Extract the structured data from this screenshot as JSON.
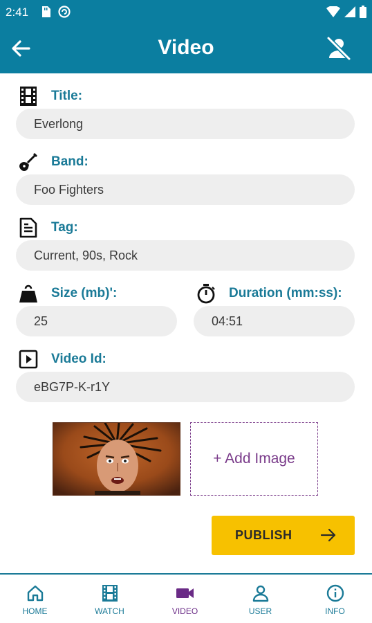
{
  "status": {
    "time": "2:41"
  },
  "header": {
    "title": "Video"
  },
  "fields": {
    "title": {
      "label": "Title:",
      "value": "Everlong"
    },
    "band": {
      "label": "Band:",
      "value": "Foo Fighters"
    },
    "tag": {
      "label": "Tag:",
      "value": "Current, 90s, Rock"
    },
    "size": {
      "label": "Size (mb)':",
      "value": "25"
    },
    "duration": {
      "label": "Duration (mm:ss):",
      "value": "04:51"
    },
    "video_id": {
      "label": "Video Id:",
      "value": "eBG7P-K-r1Y"
    }
  },
  "images": {
    "add_label": "+ Add Image"
  },
  "publish": {
    "label": "PUBLISH"
  },
  "nav": [
    {
      "label": "HOME",
      "icon": "home-icon"
    },
    {
      "label": "WATCH",
      "icon": "film-icon"
    },
    {
      "label": "VIDEO",
      "icon": "videocam-icon"
    },
    {
      "label": "USER",
      "icon": "user-icon"
    },
    {
      "label": "INFO",
      "icon": "info-icon"
    }
  ],
  "colors": {
    "primary": "#0b7ea0",
    "label": "#1a7a97",
    "active": "#6a2b86",
    "accent": "#f7c100",
    "input_bg": "#eeeeee"
  }
}
